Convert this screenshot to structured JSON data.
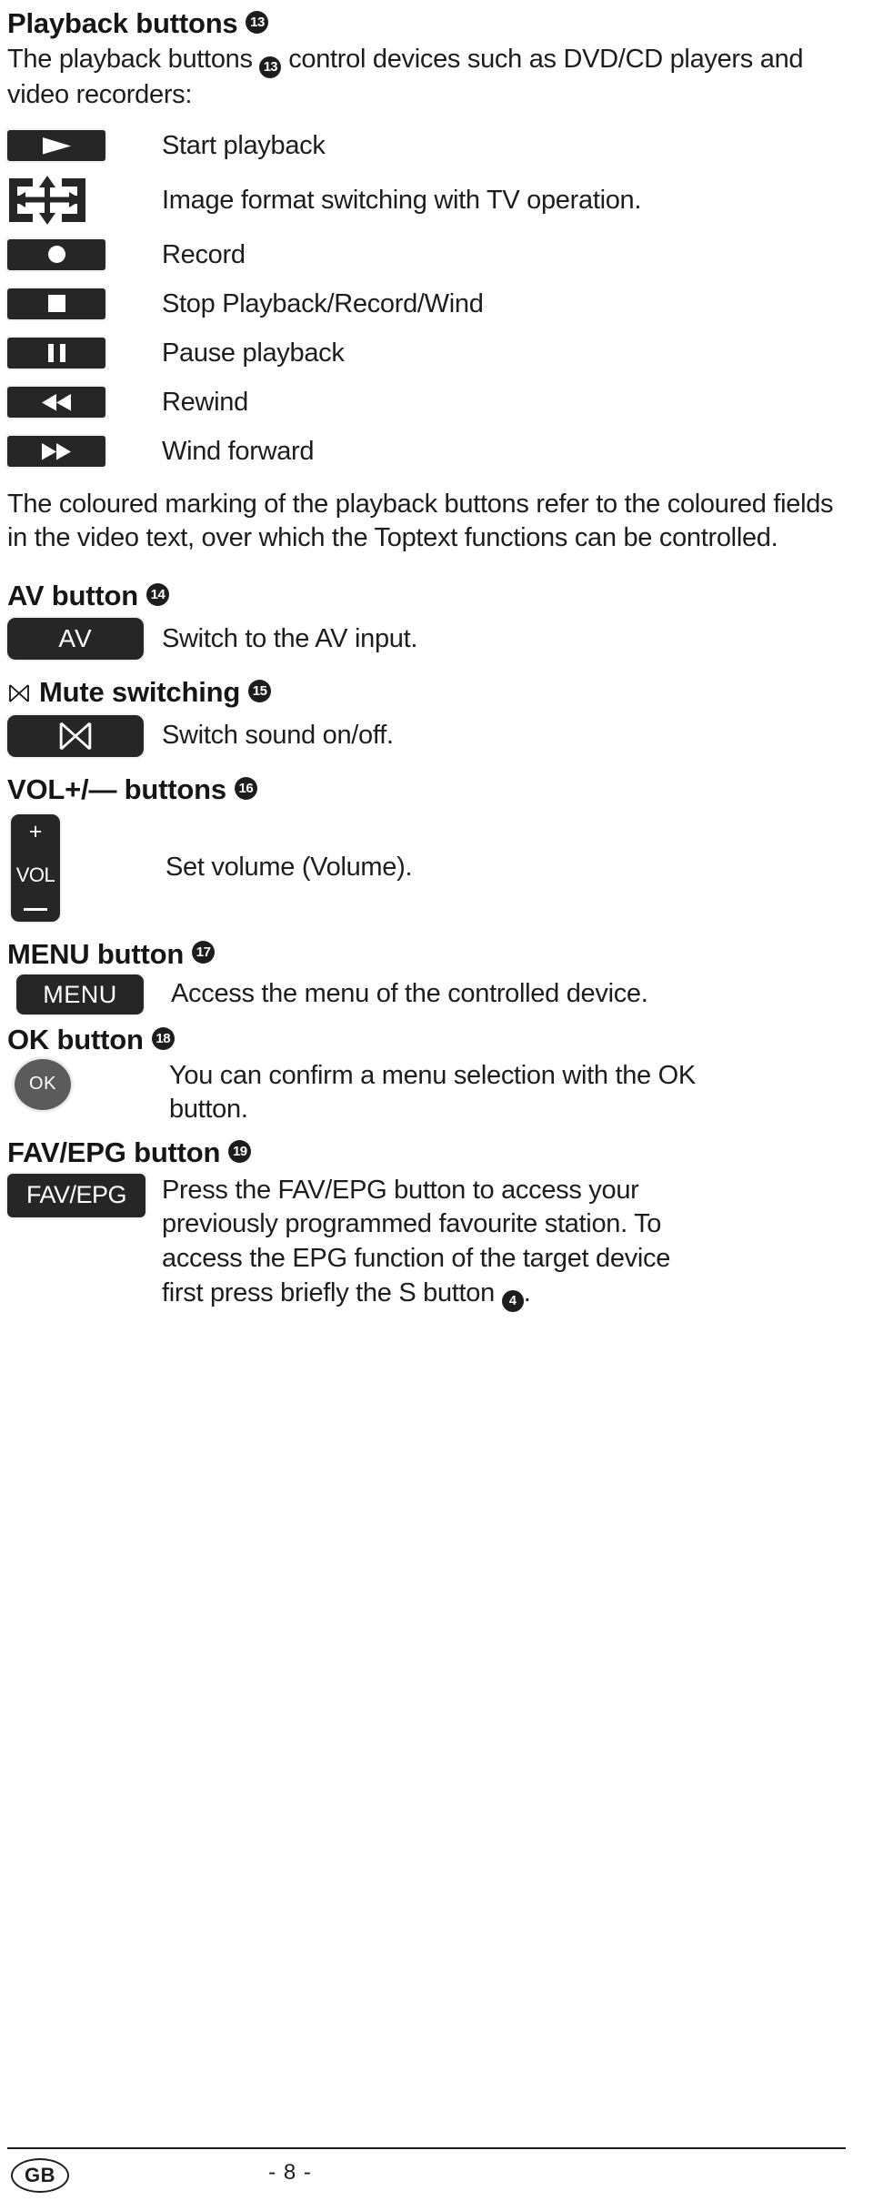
{
  "page": {
    "number_label": "- 8 -",
    "country_badge": "GB"
  },
  "sections": {
    "playback": {
      "title": "Playback buttons",
      "ref": "13",
      "intro": "The playback buttons ③ control devices such as DVD/CD players and video recorders:",
      "intro_part1": "The playback buttons ",
      "intro_ref": "13",
      "intro_part2": " control devices such as DVD/CD players and video recorders:",
      "rows": [
        {
          "icon": "play-icon",
          "label": "Start playback"
        },
        {
          "icon": "image-format-icon",
          "label": "Image format switching with TV operation."
        },
        {
          "icon": "record-icon",
          "label": "Record"
        },
        {
          "icon": "stop-icon",
          "label": "Stop Playback/Record/Wind"
        },
        {
          "icon": "pause-icon",
          "label": "Pause playback"
        },
        {
          "icon": "rewind-icon",
          "label": "Rewind"
        },
        {
          "icon": "wind-forward-icon",
          "label": "Wind forward"
        }
      ],
      "note": "The coloured marking of the playback buttons refer to the coloured fields in the video text, over which the Toptext functions can be controlled."
    },
    "av": {
      "title": "AV button",
      "ref": "14",
      "key_label": "AV",
      "description": "Switch to the AV input."
    },
    "mute": {
      "title": "Mute switching",
      "ref": "15",
      "key_icon": "mute-icon",
      "description": "Switch sound on/off."
    },
    "volume": {
      "title": "VOL+/— buttons",
      "ref": "16",
      "key_plus": "+",
      "key_label": "VOL",
      "key_minus": "—",
      "description": "Set volume (Volume)."
    },
    "menu": {
      "title": "MENU button",
      "ref": "17",
      "key_label": "MENU",
      "description": "Access the menu of the controlled device."
    },
    "ok": {
      "title": "OK button",
      "ref": "18",
      "key_label": "OK",
      "description": "You can confirm a menu selection with the OK button."
    },
    "fav_epg": {
      "title": "FAV/EPG button",
      "ref": "19",
      "key_label": "FAV/EPG",
      "description_part1": "Press the FAV/EPG button to access your previously programmed favourite station. To access the EPG function of the target device first press briefly the S button ",
      "description_ref": "4",
      "description_part2": "."
    }
  },
  "colors": {
    "key_fill": "#262626",
    "ok_fill": "#5b5b5b",
    "text": "#1d1d1d",
    "page_bg": "#ffffff"
  }
}
